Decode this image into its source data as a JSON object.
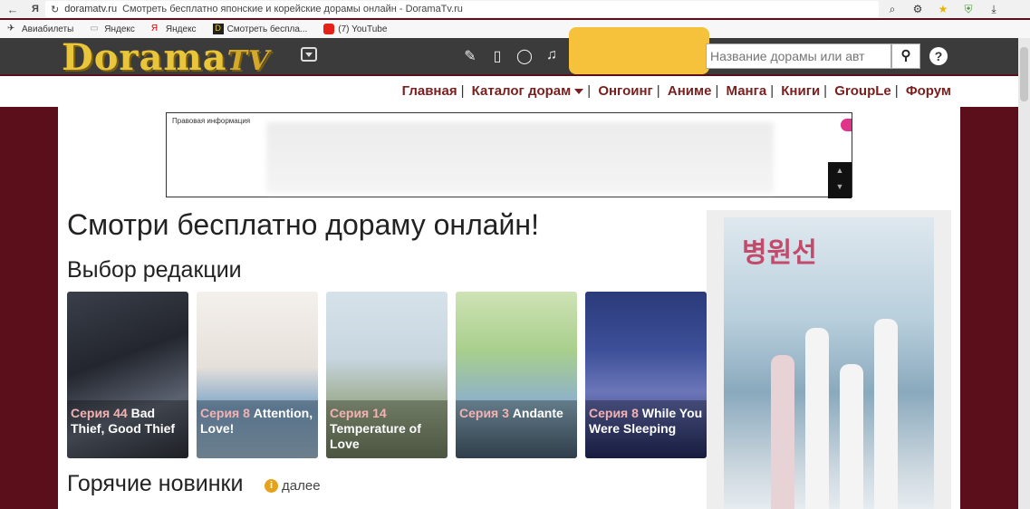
{
  "browser": {
    "url_host": "doramatv.ru",
    "url_title": "Смотреть бесплатно японские и корейские дорамы онлайн - DoramaTv.ru",
    "bookmarks": [
      {
        "label": "Авиабилеты"
      },
      {
        "label": "Яндекс"
      },
      {
        "label": "Яндекс"
      },
      {
        "label": "Смотреть беспла..."
      },
      {
        "label": "(7) YouTube"
      }
    ]
  },
  "header": {
    "logo_text": "Dorama",
    "logo_tv": "TV",
    "search_placeholder": "Название дорамы или авт"
  },
  "nav": {
    "items": [
      "Главная",
      "Каталог дорам",
      "Онгоинг",
      "Аниме",
      "Манга",
      "Книги",
      "GroupLe",
      "Форум"
    ]
  },
  "ad": {
    "label": "Правовая информация"
  },
  "main": {
    "page_title": "Смотри бесплатно дораму онлайн!",
    "editors_choice_title": "Выбор редакции",
    "cards": [
      {
        "episode": "Серия 44",
        "title": "Bad Thief, Good Thief"
      },
      {
        "episode": "Серия 8",
        "title": "Attention, Love!"
      },
      {
        "episode": "Серия 14",
        "title": "Temperature of Love"
      },
      {
        "episode": "Серия 3",
        "title": "Andante"
      },
      {
        "episode": "Серия 8",
        "title": "While You Were Sleeping"
      }
    ],
    "hot_title": "Горячие новинки",
    "hot_more": "далее"
  },
  "colors": {
    "header_bg": "#3b3b3b",
    "nav_link": "#7a1e1e",
    "page_bg": "#5a0f1a",
    "logo": "#e8c53a"
  }
}
